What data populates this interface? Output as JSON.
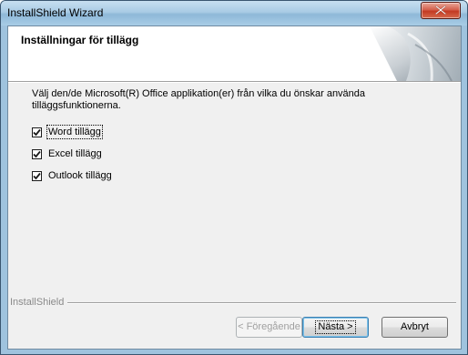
{
  "window": {
    "title": "InstallShield Wizard"
  },
  "header": {
    "title": "Inställningar för tillägg"
  },
  "main": {
    "description": "Välj den/de Microsoft(R) Office applikation(er) från vilka du önskar använda tilläggsfunktionerna.",
    "options": [
      {
        "label": "Word tillägg",
        "checked": true
      },
      {
        "label": "Excel tillägg",
        "checked": true
      },
      {
        "label": "Outlook tillägg",
        "checked": true
      }
    ]
  },
  "footer": {
    "brand": "InstallShield",
    "back_label": "< Föregående",
    "next_label": "Nästa >",
    "cancel_label": "Avbryt"
  },
  "icons": {
    "close": "close-icon",
    "check": "check-icon"
  }
}
